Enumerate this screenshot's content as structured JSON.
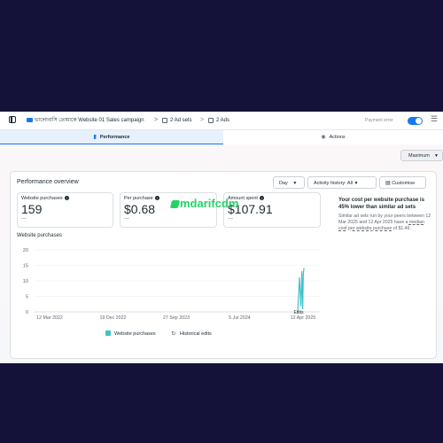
{
  "topbar": {
    "campaign_name": "ভালোবাসি তোমাকে Website 01 Sales campaign",
    "adsets_label": "2 Ad sets",
    "ads_label": "2 Ads",
    "separator": ">",
    "payment_error": "Payment error"
  },
  "tabs": [
    {
      "label": "Performance",
      "icon": "bar-chart-icon",
      "active": true
    },
    {
      "label": "Actions",
      "icon": "actions-icon",
      "active": false
    }
  ],
  "maximum_select": "Maximum",
  "overview": {
    "title": "Performance overview",
    "day_select": "Day",
    "activity_history": "Activity history: All",
    "customise": "Customise"
  },
  "metrics": [
    {
      "label": "Website purchases",
      "value": "159",
      "delta": "—"
    },
    {
      "label": "Per purchase",
      "value": "$0.68",
      "delta": "—"
    },
    {
      "label": "Amount spent",
      "value": "$107.91",
      "delta": "—"
    }
  ],
  "insight": {
    "title": "Your cost per website purchase is 45% lower than similar ad sets",
    "body_1": "Similar ad sets run by your peers between 12 Mar 2025 and 12 Apr 2025 have a ",
    "link": "median cost per website purchase",
    "body_2": " of $1.46."
  },
  "watermark": "mdarifcdm",
  "colors": {
    "accent": "#1877f2",
    "series": "#3fc1c9",
    "watermark": "#24d366"
  },
  "chart_data": {
    "type": "line",
    "title": "Website purchases",
    "xlabel": "",
    "ylabel": "",
    "x": [
      "2025-03-12",
      "2025-03-21",
      "2025-03-28",
      "2025-04-02",
      "2025-04-06",
      "2025-04-09",
      "2025-04-12"
    ],
    "series": [
      {
        "name": "Website purchases",
        "values": [
          0,
          11,
          2,
          13,
          1,
          12,
          14
        ]
      }
    ],
    "x_tick_labels": [
      "12 Mar 2022",
      "19 Dec 2022",
      "27 Sep 2023",
      "5 Jul 2024",
      "12 Apr 2025"
    ],
    "y_ticks": [
      0,
      5,
      10,
      15,
      20
    ],
    "ylim": [
      0,
      20
    ],
    "grid": true,
    "legend": [
      "Website purchases",
      "Historical edits"
    ],
    "legend_placement": "bottom",
    "annotation": "Edits"
  }
}
